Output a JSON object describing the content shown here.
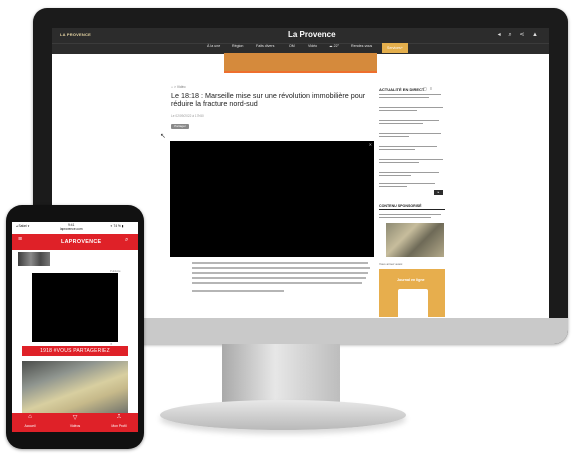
{
  "desktop": {
    "header": {
      "brand_left": "LA PROVENCE",
      "logo": "La Provence",
      "icons": [
        "share-icon",
        "search-icon",
        "sharing-icon",
        "user-icon"
      ],
      "icon_glyphs": "◂ ⌕ ⋖ ▲"
    },
    "nav": {
      "items": [
        "À la une",
        "Région",
        "Faits divers",
        "OM",
        "Vidéo",
        "☁ 22°",
        "Rendez-vous"
      ],
      "cta": "Services+"
    },
    "article": {
      "breadcrumb": "⌂ > Vidéo",
      "headline": "Le 18:18 : Marseille mise sur une révolution immobilière pour réduire la fracture nord-sud",
      "dateline": "Le 02/09/2022 à 17h50",
      "share_label": "Partager"
    },
    "sidebar": {
      "live_title": "ACTUALITÉ EN DIRECT",
      "live_controls": "▢ ≡",
      "sponsored_title": "CONTENU SPONSORISÉ",
      "sponsored_label": "Vous aimez aussi",
      "promo_title": "Journal en ligne",
      "more_button": "▸"
    },
    "video_close": "✕",
    "cursor_glyph": "↖"
  },
  "phone": {
    "status": {
      "left": "◂ Safari ▾",
      "center": "9:41\nlaprovence.com",
      "right": "✦ 74 % ▮"
    },
    "header": {
      "menu_glyph": "≡",
      "logo": "LAPROVENCE",
      "search_glyph": "⌕"
    },
    "meta": "Publicité",
    "ad_close": "✕",
    "banner": "1918 #VOUS PARTAGERIEZ",
    "tabs": [
      {
        "icon": "⌂",
        "label": "Accueil"
      },
      {
        "icon": "▽",
        "label": "Vidéos"
      },
      {
        "icon": "⎍",
        "label": "Mon Profil"
      }
    ]
  },
  "colors": {
    "brand_red": "#df2128",
    "header_dark": "#2c2c2c",
    "accent_orange": "#e3ae4c"
  }
}
